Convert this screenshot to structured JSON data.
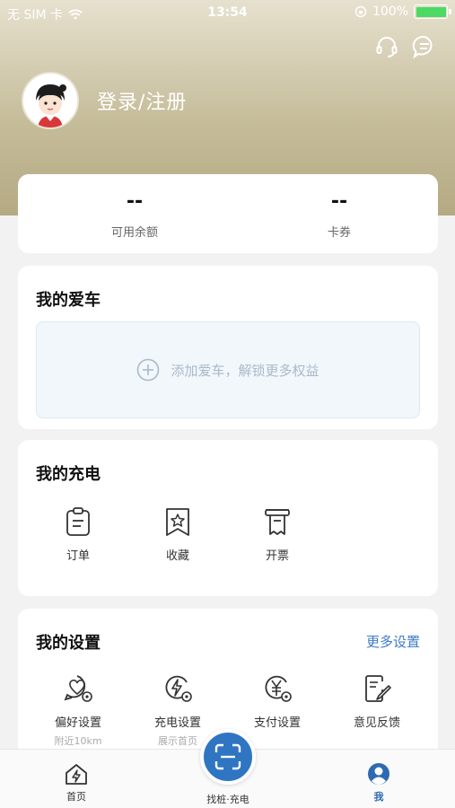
{
  "status_bar": {
    "carrier": "无 SIM 卡",
    "time": "13:54",
    "battery": "100%"
  },
  "header": {
    "login_text": "登录/注册",
    "icons": [
      "headset-icon",
      "message-icon"
    ]
  },
  "balance": {
    "items": [
      {
        "value": "--",
        "label": "可用余额"
      },
      {
        "value": "--",
        "label": "卡券"
      }
    ]
  },
  "my_car": {
    "title": "我的爱车",
    "add_text": "添加爱车，解锁更多权益"
  },
  "my_charge": {
    "title": "我的充电",
    "items": [
      {
        "label": "订单",
        "icon": "clipboard-icon"
      },
      {
        "label": "收藏",
        "icon": "bookmark-star-icon"
      },
      {
        "label": "开票",
        "icon": "receipt-icon"
      }
    ]
  },
  "my_settings": {
    "title": "我的设置",
    "more": "更多设置",
    "items": [
      {
        "label": "偏好设置",
        "sub": "附近10km",
        "icon": "heart-settings-icon"
      },
      {
        "label": "充电设置",
        "sub": "展示首页",
        "icon": "charge-settings-icon"
      },
      {
        "label": "支付设置",
        "sub": "",
        "icon": "yen-settings-icon"
      },
      {
        "label": "意见反馈",
        "sub": "",
        "icon": "feedback-icon"
      }
    ]
  },
  "tabbar": {
    "home": "首页",
    "scan": "找桩·充电",
    "me": "我"
  },
  "colors": {
    "accent": "#2f75c2",
    "link": "#3e7bc6",
    "header_gold": "#c6bd9b",
    "battery": "#4cd964"
  }
}
